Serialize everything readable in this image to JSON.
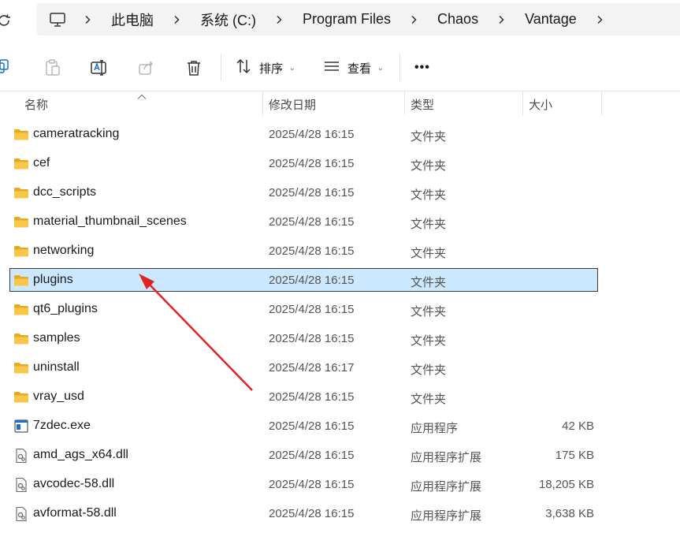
{
  "breadcrumb": [
    "此电脑",
    "系统 (C:)",
    "Program Files",
    "Chaos",
    "Vantage"
  ],
  "toolbar": {
    "sort_label": "排序",
    "view_label": "查看",
    "more_label": "•••"
  },
  "columns": {
    "name": "名称",
    "date": "修改日期",
    "type": "类型",
    "size": "大小"
  },
  "files": [
    {
      "name": "cameratracking",
      "date": "2025/4/28 16:15",
      "type": "文件夹",
      "size": "",
      "icon": "folder-icon"
    },
    {
      "name": "cef",
      "date": "2025/4/28 16:15",
      "type": "文件夹",
      "size": "",
      "icon": "folder-icon"
    },
    {
      "name": "dcc_scripts",
      "date": "2025/4/28 16:15",
      "type": "文件夹",
      "size": "",
      "icon": "folder-icon"
    },
    {
      "name": "material_thumbnail_scenes",
      "date": "2025/4/28 16:15",
      "type": "文件夹",
      "size": "",
      "icon": "folder-icon"
    },
    {
      "name": "networking",
      "date": "2025/4/28 16:15",
      "type": "文件夹",
      "size": "",
      "icon": "folder-icon"
    },
    {
      "name": "plugins",
      "date": "2025/4/28 16:15",
      "type": "文件夹",
      "size": "",
      "icon": "folder-icon",
      "selected": true
    },
    {
      "name": "qt6_plugins",
      "date": "2025/4/28 16:15",
      "type": "文件夹",
      "size": "",
      "icon": "folder-icon"
    },
    {
      "name": "samples",
      "date": "2025/4/28 16:15",
      "type": "文件夹",
      "size": "",
      "icon": "folder-icon"
    },
    {
      "name": "uninstall",
      "date": "2025/4/28 16:17",
      "type": "文件夹",
      "size": "",
      "icon": "folder-icon"
    },
    {
      "name": "vray_usd",
      "date": "2025/4/28 16:15",
      "type": "文件夹",
      "size": "",
      "icon": "folder-icon"
    },
    {
      "name": "7zdec.exe",
      "date": "2025/4/28 16:15",
      "type": "应用程序",
      "size": "42 KB",
      "icon": "exe-icon"
    },
    {
      "name": "amd_ags_x64.dll",
      "date": "2025/4/28 16:15",
      "type": "应用程序扩展",
      "size": "175 KB",
      "icon": "dll-icon"
    },
    {
      "name": "avcodec-58.dll",
      "date": "2025/4/28 16:15",
      "type": "应用程序扩展",
      "size": "18,205 KB",
      "icon": "dll-icon"
    },
    {
      "name": "avformat-58.dll",
      "date": "2025/4/28 16:15",
      "type": "应用程序扩展",
      "size": "3,638 KB",
      "icon": "dll-icon"
    }
  ],
  "colors": {
    "selection_bg": "#cce8ff",
    "folder": "#f8c74a",
    "annotation_arrow": "#e02424"
  }
}
